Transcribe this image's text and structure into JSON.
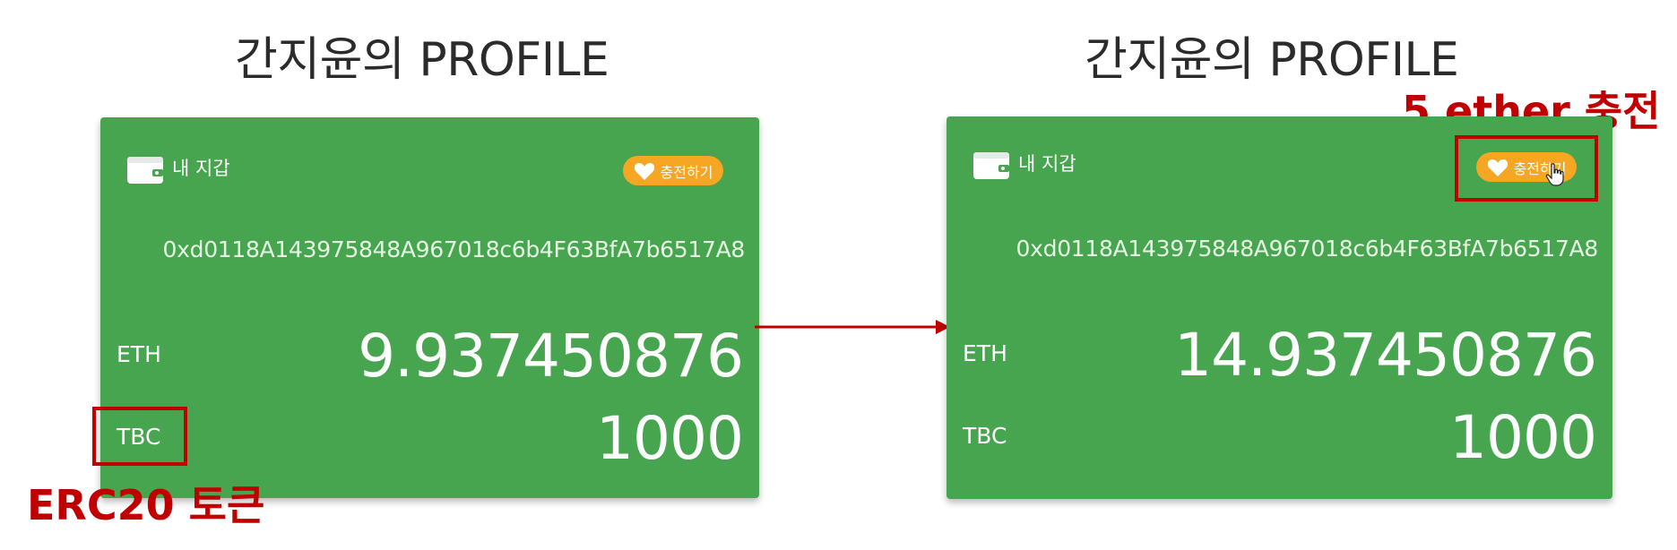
{
  "profiles": [
    {
      "title": "간지윤의 PROFILE",
      "wallet_label": "내 지갑",
      "charge_label": "충전하기",
      "address": "0xd0118A143975848A967018c6b4F63BfA7b6517A8",
      "eth_label": "ETH",
      "eth_value": "9.937450876",
      "tbc_label": "TBC",
      "tbc_value": "1000"
    },
    {
      "title": "간지윤의 PROFILE",
      "wallet_label": "내 지갑",
      "charge_label": "충전하기",
      "address": "0xd0118A143975848A967018c6b4F63BfA7b6517A8",
      "eth_label": "ETH",
      "eth_value": "14.937450876",
      "tbc_label": "TBC",
      "tbc_value": "1000"
    }
  ],
  "annotations": {
    "erc20_note": "ERC20 토큰",
    "charge_note": "5 ether 충전",
    "color": "#c00000"
  },
  "colors": {
    "card_bg": "#47a54f",
    "button_bg": "#f5a623"
  },
  "icons": [
    "wallet-icon",
    "heart-icon",
    "hand-pointer-icon",
    "arrow-right-icon"
  ]
}
